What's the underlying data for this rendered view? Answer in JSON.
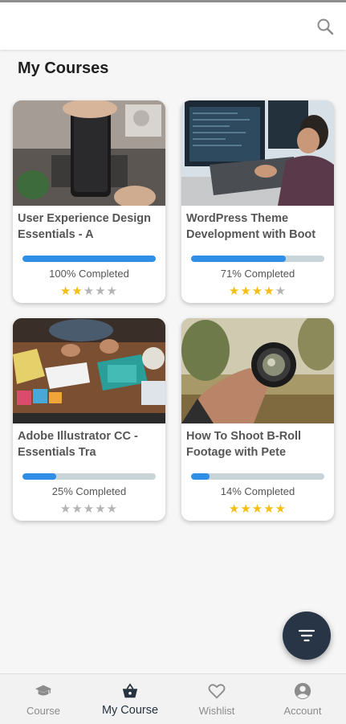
{
  "header": {
    "search_icon": "search-icon"
  },
  "page": {
    "title": "My Courses"
  },
  "courses": [
    {
      "title": "User Experience Design\nEssentials - A",
      "progress": 100,
      "progress_label": "100% Completed",
      "rating": 2
    },
    {
      "title": "WordPress Theme\nDevelopment with Boot",
      "progress": 71,
      "progress_label": "71% Completed",
      "rating": 4
    },
    {
      "title": "Adobe Illustrator CC -\nEssentials Tra",
      "progress": 25,
      "progress_label": "25% Completed",
      "rating": 0
    },
    {
      "title": "How To Shoot B-Roll\nFootage with Pete",
      "progress": 14,
      "progress_label": "14% Completed",
      "rating": 5
    }
  ],
  "fab": {
    "icon": "filter-icon"
  },
  "nav": {
    "active_index": 1,
    "items": [
      {
        "label": "Course",
        "icon": "graduation-cap-icon"
      },
      {
        "label": "My Course",
        "icon": "basket-icon"
      },
      {
        "label": "Wishlist",
        "icon": "heart-icon"
      },
      {
        "label": "Account",
        "icon": "account-icon"
      }
    ]
  },
  "colors": {
    "progress_fill": "#2f8ee6",
    "progress_track": "#c9d4d8",
    "star_on": "#f5be10",
    "star_off": "#b4b4b4",
    "fab_bg": "#273546",
    "nav_active": "#26323f"
  }
}
